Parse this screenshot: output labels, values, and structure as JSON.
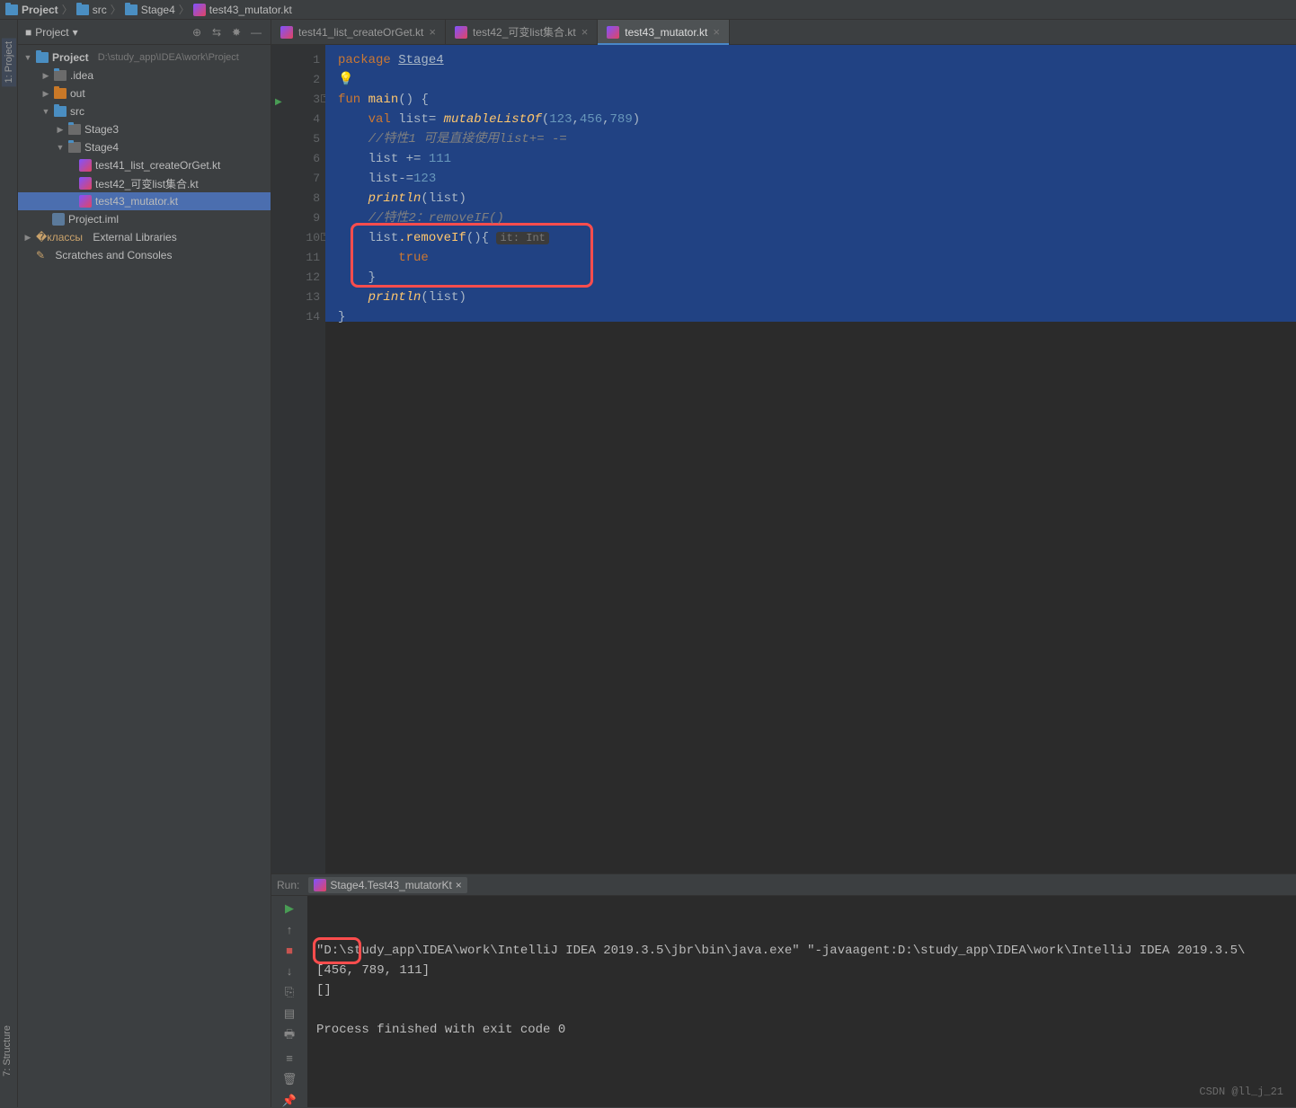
{
  "breadcrumb": {
    "items": [
      "Project",
      "src",
      "Stage4",
      "test43_mutator.kt"
    ]
  },
  "sidebar": {
    "title": "Project",
    "root": {
      "name": "Project",
      "path": "D:\\study_app\\IDEA\\work\\Project"
    },
    "nodes": {
      "idea": ".idea",
      "out": "out",
      "src": "src",
      "stage3": "Stage3",
      "stage4": "Stage4",
      "f1": "test41_list_createOrGet.kt",
      "f2": "test42_可变list集合.kt",
      "f3": "test43_mutator.kt",
      "iml": "Project.iml",
      "ext": "External Libraries",
      "scr": "Scratches and Consoles"
    }
  },
  "tabs": {
    "t1": "test41_list_createOrGet.kt",
    "t2": "test42_可变list集合.kt",
    "t3": "test43_mutator.kt"
  },
  "code": {
    "l1_kw": "package",
    "l1_pkg": "Stage4",
    "l3_fun": "fun",
    "l3_main": "main",
    "l4_val": "val",
    "l4_list": "list",
    "l4_eq": "=",
    "l4_fn": "mutableListOf",
    "l4_n1": "123",
    "l4_n2": "456",
    "l4_n3": "789",
    "l5": "//特性1 可是直接使用list+= -=",
    "l6_list": "list",
    "l6_op": "+=",
    "l6_n": "111",
    "l7_list": "list",
    "l7_op": "-=",
    "l7_n": "123",
    "l8_fn": "println",
    "l8_arg": "list",
    "l9": "//特性2：removeIF()",
    "l10_list": "list",
    "l10_rm": ".removeIf",
    "l10_hint": "it: Int",
    "l11_true": "true",
    "l13_fn": "println",
    "l13_arg": "list"
  },
  "leftTabs": {
    "project": "1: Project",
    "structure": "7: Structure"
  },
  "run": {
    "label": "Run:",
    "tab": "Stage4.Test43_mutatorKt",
    "line1": "\"D:\\study_app\\IDEA\\work\\IntelliJ IDEA 2019.3.5\\jbr\\bin\\java.exe\" \"-javaagent:D:\\study_app\\IDEA\\work\\IntelliJ IDEA 2019.3.5\\",
    "line2": "[456, 789, 111]",
    "line3": "[]",
    "line4": "Process finished with exit code 0"
  },
  "watermark": "CSDN @ll_j_21"
}
